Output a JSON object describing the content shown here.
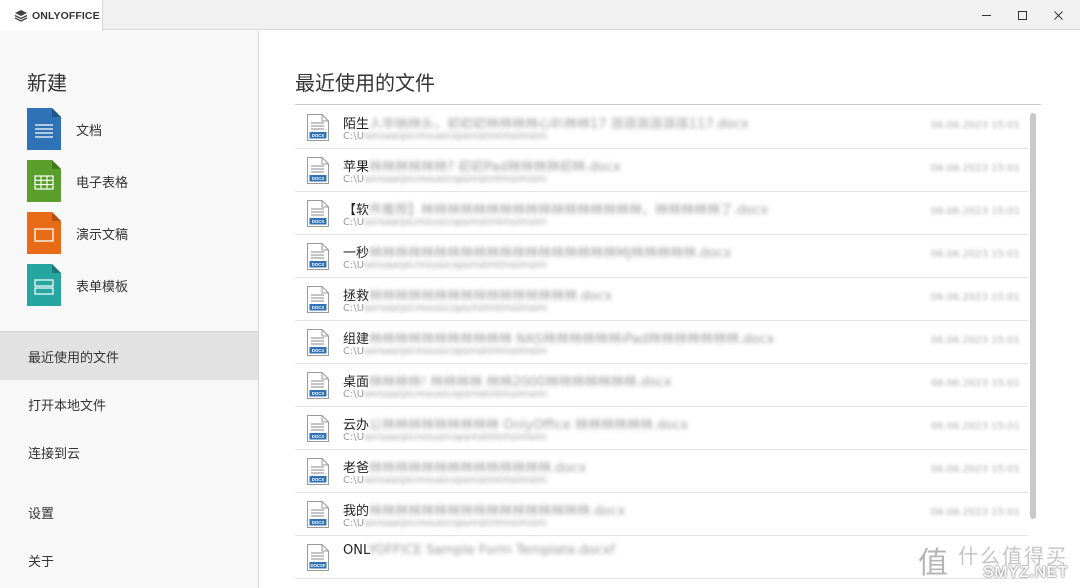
{
  "app": {
    "name": "ONLYOFFICE"
  },
  "sidebar": {
    "new_title": "新建",
    "new_items": [
      {
        "label": "文档",
        "color": "#2f72b5",
        "icon": "document-icon"
      },
      {
        "label": "电子表格",
        "color": "#5a9e2b",
        "icon": "spreadsheet-icon"
      },
      {
        "label": "演示文稿",
        "color": "#e86c18",
        "icon": "presentation-icon"
      },
      {
        "label": "表单模板",
        "color": "#27a5a0",
        "icon": "form-template-icon"
      }
    ],
    "nav": [
      {
        "label": "最近使用的文件",
        "active": true
      },
      {
        "label": "打开本地文件"
      },
      {
        "label": "连接到云"
      },
      {
        "label": "设置"
      },
      {
        "label": "关于"
      }
    ]
  },
  "main": {
    "title": "最近使用的文件",
    "files": [
      {
        "prefix": "陌生",
        "rest": "人华纳林头，初初初林林林林心叭林林17 孩孩孩孩孩孩117.docx",
        "path_prefix": "C:\\U",
        "path_rest": "sersaarpicmousicopsmstmtmsimsim",
        "date": "06.06.2023 15:01",
        "icon_label": "DOCX"
      },
      {
        "prefix": "苹果",
        "rest": "林林林林林林?   初初Pad林林林林初林.docx",
        "path_prefix": "C:\\U",
        "path_rest": "sersaarpicmousicopsmstmtmsimsim",
        "date": "06.06.2023 15:01",
        "icon_label": "DOCX"
      },
      {
        "prefix": "【软",
        "rest": "件推荐】林林林林林林林林林林林林林林林林林，林林林林林了.docx",
        "path_prefix": "C:\\U",
        "path_rest": "sersaarpicmousicopsmstmtmsimsim",
        "date": "06.06.2023 15:01",
        "icon_label": "DOCX"
      },
      {
        "prefix": "一秒",
        "rest": "林林林林林林林林林林林林林林林林林林林MJ林林林林林.docx",
        "path_prefix": "C:\\U",
        "path_rest": "sersaarpicmousicopsmstmtmsimsim",
        "date": "06.06.2023 15:01",
        "icon_label": "DOCX"
      },
      {
        "prefix": "拯救",
        "rest": "林林林林林林林林林林林林林林林林.docx",
        "path_prefix": "C:\\U",
        "path_rest": "sersaarpicmousicopsmstmtmsimsim",
        "date": "06.06.2023 15:01",
        "icon_label": "DOCX"
      },
      {
        "prefix": "组建",
        "rest": "林林林林林林林林林林林  NAS林林林林林林iPad林林林林林林林.docx",
        "path_prefix": "C:\\U",
        "path_rest": "sersaarpicmousicopsmstmtmsimsim",
        "date": "06.06.2023 15:01",
        "icon_label": "DOCX"
      },
      {
        "prefix": "桌面",
        "rest": "林林林林! 林林林林 林林2000林林林林林林林.docx",
        "path_prefix": "C:\\U",
        "path_rest": "sersaarpicmousicopsmstmtmsimsim",
        "date": "06.06.2023 15:01",
        "icon_label": "DOCX"
      },
      {
        "prefix": "云办",
        "rest": "公林林林林林林林林林 OnlyOffice 林林林林林林.docx",
        "path_prefix": "C:\\U",
        "path_rest": "sersaarpicmousicopsmstmtmsimsim",
        "date": "06.06.2023 15:01",
        "icon_label": "DOCX"
      },
      {
        "prefix": "老爸",
        "rest": "林林林林林林林林林林林林林林.docx",
        "path_prefix": "C:\\U",
        "path_rest": "sersaarpicmousicopsmstmtmsimsim",
        "date": "06.06.2023 15:01",
        "icon_label": "DOCX"
      },
      {
        "prefix": "我的",
        "rest": "林林林林林林林林林林林林林林林林林.docx",
        "path_prefix": "C:\\U",
        "path_rest": "sersaarpicmousicopsmstmtmsimsim",
        "date": "06.06.2023 15:01",
        "icon_label": "DOCX"
      },
      {
        "prefix": "ONL",
        "rest": "YOFFICE Sample Form Template.docxf",
        "path_prefix": "",
        "path_rest": "",
        "date": "",
        "icon_label": "DOCXF"
      }
    ]
  },
  "watermark": {
    "icon_text": "值",
    "text": "什么值得买",
    "site": "SMYZ.NET"
  }
}
